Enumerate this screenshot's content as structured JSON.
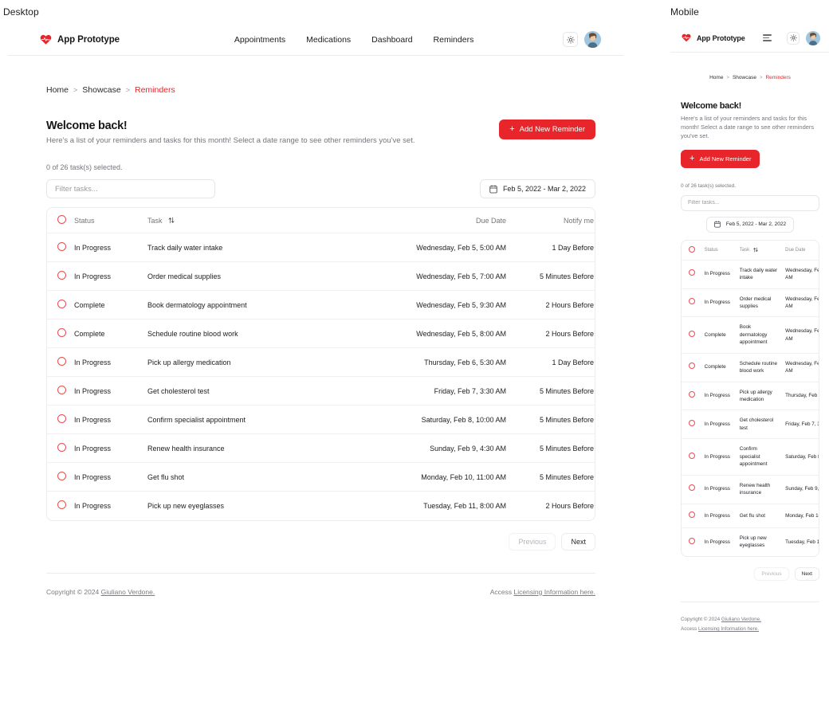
{
  "viewports": {
    "desktop_label": "Desktop",
    "mobile_label": "Mobile"
  },
  "colors": {
    "brand_red": "#e8252a",
    "accent_link": "#e8252a",
    "text_muted": "#75757c",
    "border": "#ececee"
  },
  "header": {
    "brand": "App Prototype",
    "logo_icon": "heart-pulse-icon",
    "nav": [
      {
        "label": "Appointments"
      },
      {
        "label": "Medications"
      },
      {
        "label": "Dashboard"
      },
      {
        "label": "Reminders"
      }
    ],
    "theme_toggle_icon": "sun-icon",
    "menu_icon": "hamburger-icon",
    "avatar_icon": "user-avatar"
  },
  "breadcrumb": [
    {
      "label": "Home",
      "current": false
    },
    {
      "label": "Showcase",
      "current": false
    },
    {
      "label": "Reminders",
      "current": true
    }
  ],
  "breadcrumb_separator": ">",
  "main": {
    "title": "Welcome back!",
    "subtitle": "Here's a list of your reminders and tasks for this month! Select a date range to see other reminders you've set.",
    "add_button_label": "Add New Reminder",
    "add_button_icon": "plus-icon",
    "selected_count": "0 of 26 task(s) selected.",
    "filter_placeholder": "Filter tasks...",
    "filter_value": "",
    "date_range": "Feb 5, 2022 - Mar 2, 2022",
    "calendar_icon": "calendar-icon"
  },
  "table": {
    "columns": [
      {
        "key": "select",
        "label": "",
        "icon": "circle-checkbox-icon"
      },
      {
        "key": "status",
        "label": "Status"
      },
      {
        "key": "task",
        "label": "Task",
        "icon": "sort-updown-icon"
      },
      {
        "key": "due_date",
        "label": "Due Date"
      },
      {
        "key": "notify",
        "label": "Notify me"
      },
      {
        "key": "actions",
        "label": ""
      }
    ],
    "rows": [
      {
        "status": "In Progress",
        "task": "Track daily water intake",
        "due_date": "Wednesday, Feb 5, 5:00 AM",
        "notify": "1 Day Before"
      },
      {
        "status": "In Progress",
        "task": "Order medical supplies",
        "due_date": "Wednesday, Feb 5, 7:00 AM",
        "notify": "5 Minutes Before"
      },
      {
        "status": "Complete",
        "task": "Book dermatology appointment",
        "due_date": "Wednesday, Feb 5, 9:30 AM",
        "notify": "2 Hours Before"
      },
      {
        "status": "Complete",
        "task": "Schedule routine blood work",
        "due_date": "Wednesday, Feb 5, 8:00 AM",
        "notify": "2 Hours Before"
      },
      {
        "status": "In Progress",
        "task": "Pick up allergy medication",
        "due_date": "Thursday, Feb 6, 5:30 AM",
        "notify": "1 Day Before"
      },
      {
        "status": "In Progress",
        "task": "Get cholesterol test",
        "due_date": "Friday, Feb 7, 3:30 AM",
        "notify": "5 Minutes Before"
      },
      {
        "status": "In Progress",
        "task": "Confirm specialist appointment",
        "due_date": "Saturday, Feb 8, 10:00 AM",
        "notify": "5 Minutes Before"
      },
      {
        "status": "In Progress",
        "task": "Renew health insurance",
        "due_date": "Sunday, Feb 9, 4:30 AM",
        "notify": "5 Minutes Before"
      },
      {
        "status": "In Progress",
        "task": "Get flu shot",
        "due_date": "Monday, Feb 10, 11:00 AM",
        "notify": "5 Minutes Before"
      },
      {
        "status": "In Progress",
        "task": "Pick up new eyeglasses",
        "due_date": "Tuesday, Feb 11, 8:00 AM",
        "notify": "2 Hours Before"
      }
    ],
    "row_menu_label": "···"
  },
  "pagination": {
    "previous_label": "Previous",
    "next_label": "Next",
    "previous_disabled": true
  },
  "footer": {
    "copyright_prefix": "Copyright © 2024 ",
    "copyright_link": "Giuliano Verdone.",
    "license_prefix": "Access ",
    "license_link": "Licensing Information here."
  }
}
